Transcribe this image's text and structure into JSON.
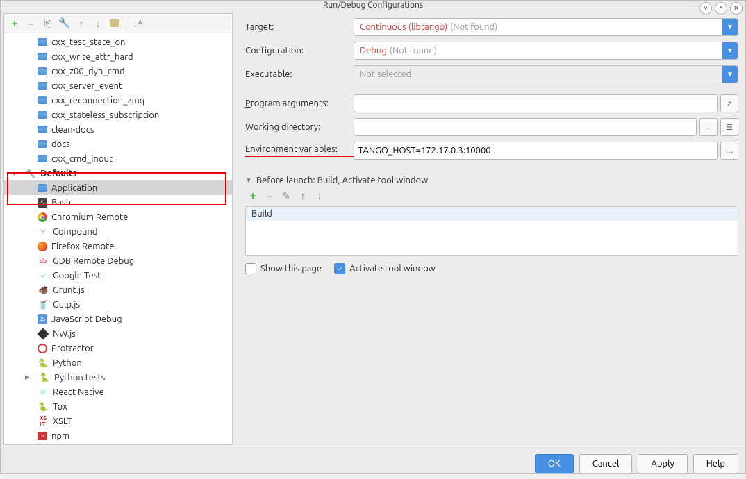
{
  "window": {
    "title": "Run/Debug Configurations"
  },
  "toolbar": {
    "add": "+",
    "remove": "−",
    "copy": "⎘",
    "tools": "⚙",
    "up": "↑",
    "down": "↓",
    "folder": "📁",
    "sort": "↓ᴬ"
  },
  "tree": {
    "top_items": [
      "cxx_test_state_on",
      "cxx_write_attr_hard",
      "cxx_z00_dyn_cmd",
      "cxx_server_event",
      "cxx_reconnection_zmq",
      "cxx_stateless_subscription",
      "clean-docs",
      "docs",
      "cxx_cmd_inout"
    ],
    "defaults_label": "Defaults",
    "defaults": [
      {
        "label": "Application",
        "icon": "app",
        "selected": true
      },
      {
        "label": "Bash",
        "icon": "bash"
      },
      {
        "label": "Chromium Remote",
        "icon": "chrome"
      },
      {
        "label": "Compound",
        "icon": "comp"
      },
      {
        "label": "Firefox Remote",
        "icon": "ff"
      },
      {
        "label": "GDB Remote Debug",
        "icon": "gdb"
      },
      {
        "label": "Google Test",
        "icon": "gtest"
      },
      {
        "label": "Grunt.js",
        "icon": "grunt"
      },
      {
        "label": "Gulp.js",
        "icon": "gulp"
      },
      {
        "label": "JavaScript Debug",
        "icon": "js"
      },
      {
        "label": "NW.js",
        "icon": "nw"
      },
      {
        "label": "Protractor",
        "icon": "pro"
      },
      {
        "label": "Python",
        "icon": "py"
      },
      {
        "label": "Python tests",
        "icon": "py",
        "expandable": true
      },
      {
        "label": "React Native",
        "icon": "react"
      },
      {
        "label": "Tox",
        "icon": "tox"
      },
      {
        "label": "XSLT",
        "icon": "xslt"
      },
      {
        "label": "npm",
        "icon": "npm"
      }
    ]
  },
  "form": {
    "target_label": "Target:",
    "target_value": "Continuous (libtango)",
    "target_suffix": "(Not found)",
    "config_label": "Configuration:",
    "config_value": "Debug",
    "config_suffix": "(Not found)",
    "exec_label": "Executable:",
    "exec_value": "Not selected",
    "args_label": "Program arguments:",
    "args_value": "",
    "wd_label_pre": "",
    "wd_ul": "W",
    "wd_label_post": "orking directory:",
    "wd_value": "",
    "env_label_pre": "",
    "env_ul": "E",
    "env_label_post": "nvironment variables:",
    "env_value": "TANGO_HOST=172.17.0.3:10000"
  },
  "before": {
    "header_pre": "",
    "header_ul": "B",
    "header_post": "efore launch: Build, Activate tool window",
    "list": [
      "Build"
    ]
  },
  "checks": {
    "show_page": "Show this page",
    "activate": "Activate tool window"
  },
  "buttons": {
    "ok": "OK",
    "cancel": "Cancel",
    "apply": "Apply",
    "help": "Help"
  }
}
